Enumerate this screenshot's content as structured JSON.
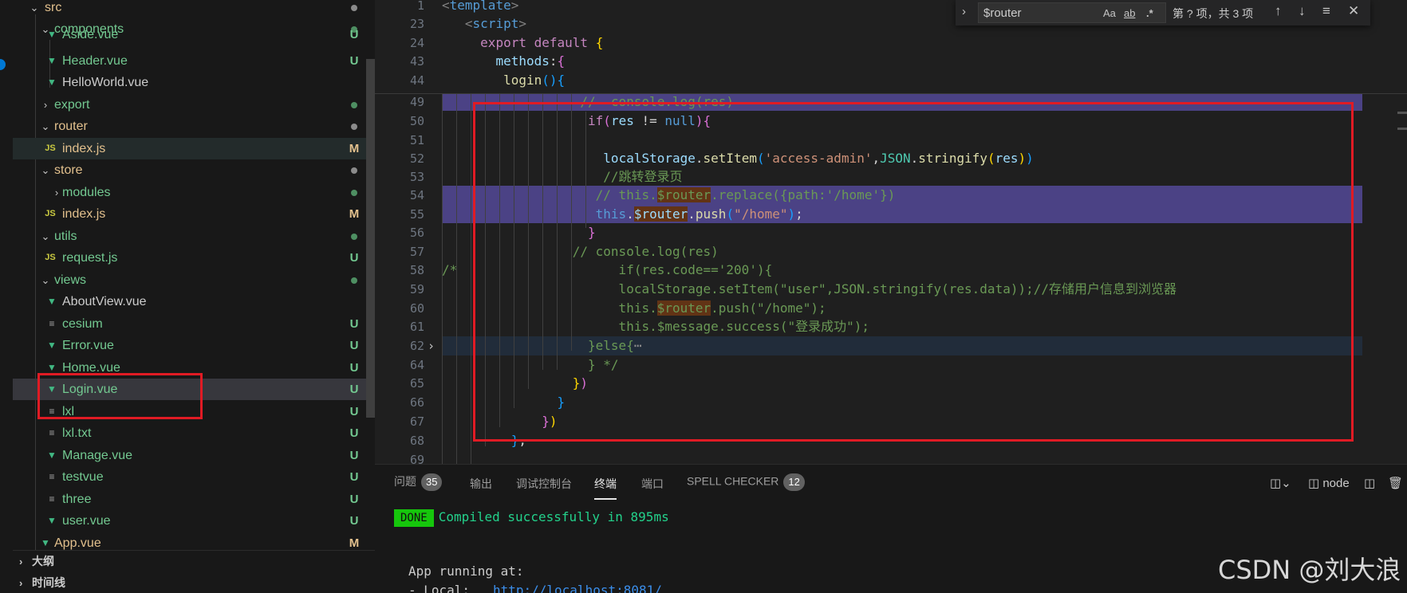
{
  "explorer": {
    "items": [
      {
        "name": "src",
        "kind": "folder-open",
        "status": "",
        "dot": "gray"
      },
      {
        "name": "components",
        "kind": "folder-open",
        "status": "",
        "dot": "green"
      },
      {
        "name": "Aside.vue",
        "kind": "vue",
        "status": "U"
      },
      {
        "name": "Header.vue",
        "kind": "vue",
        "status": "U"
      },
      {
        "name": "HelloWorld.vue",
        "kind": "vue",
        "status": ""
      },
      {
        "name": "export",
        "kind": "folder",
        "status": "",
        "dot": "green"
      },
      {
        "name": "router",
        "kind": "folder-open",
        "status": "",
        "dot": "gray"
      },
      {
        "name": "index.js",
        "kind": "js",
        "status": "M"
      },
      {
        "name": "store",
        "kind": "folder-open",
        "status": "",
        "dot": "gray"
      },
      {
        "name": "modules",
        "kind": "folder",
        "status": "",
        "dot": "green"
      },
      {
        "name": "index.js",
        "kind": "js",
        "status": "M"
      },
      {
        "name": "utils",
        "kind": "folder-open",
        "status": "",
        "dot": "green"
      },
      {
        "name": "request.js",
        "kind": "js",
        "status": "U"
      },
      {
        "name": "views",
        "kind": "folder-open",
        "status": "",
        "dot": "green"
      },
      {
        "name": "AboutView.vue",
        "kind": "vue",
        "status": ""
      },
      {
        "name": "cesium",
        "kind": "txt",
        "status": "U"
      },
      {
        "name": "Error.vue",
        "kind": "vue",
        "status": "U"
      },
      {
        "name": "Home.vue",
        "kind": "vue",
        "status": "U"
      },
      {
        "name": "Login.vue",
        "kind": "vue",
        "status": "U"
      },
      {
        "name": "lxl",
        "kind": "txt",
        "status": "U"
      },
      {
        "name": "lxl.txt",
        "kind": "txt",
        "status": "U"
      },
      {
        "name": "Manage.vue",
        "kind": "vue",
        "status": "U"
      },
      {
        "name": "testvue",
        "kind": "txt",
        "status": "U"
      },
      {
        "name": "three",
        "kind": "txt",
        "status": "U"
      },
      {
        "name": "user.vue",
        "kind": "vue",
        "status": "U"
      },
      {
        "name": "App.vue",
        "kind": "vue",
        "status": "M"
      }
    ],
    "sections": [
      {
        "label": "大纲"
      },
      {
        "label": "时间线"
      }
    ]
  },
  "find": {
    "value": "$router",
    "opt_case": "Aa",
    "opt_word": "ab",
    "opt_regex": ".*",
    "count": "第 ? 项，共 3 项"
  },
  "editor": {
    "lines": [
      {
        "n": "1"
      },
      {
        "n": "23"
      },
      {
        "n": "24"
      },
      {
        "n": "43"
      },
      {
        "n": "44"
      },
      {
        "n": "49"
      },
      {
        "n": "50"
      },
      {
        "n": "51"
      },
      {
        "n": "52"
      },
      {
        "n": "53"
      },
      {
        "n": "54"
      },
      {
        "n": "55"
      },
      {
        "n": "56"
      },
      {
        "n": "57"
      },
      {
        "n": "58"
      },
      {
        "n": "59"
      },
      {
        "n": "60"
      },
      {
        "n": "61"
      },
      {
        "n": "62"
      },
      {
        "n": "64"
      },
      {
        "n": "65"
      },
      {
        "n": "66"
      },
      {
        "n": "67"
      },
      {
        "n": "68"
      },
      {
        "n": "69"
      }
    ]
  },
  "panel": {
    "tabs": [
      {
        "label": "问题",
        "badge": "35"
      },
      {
        "label": "输出",
        "badge": ""
      },
      {
        "label": "调试控制台",
        "badge": ""
      },
      {
        "label": "终端",
        "badge": ""
      },
      {
        "label": "端口",
        "badge": ""
      },
      {
        "label": "SPELL CHECKER",
        "badge": "12"
      }
    ],
    "shell": "node",
    "done": "DONE",
    "compiled": "Compiled successfully in 895ms",
    "running": "App running at:",
    "local_label": "- Local:",
    "local_url": "http://localhost:8081/"
  },
  "watermark": "CSDN @刘大浪"
}
